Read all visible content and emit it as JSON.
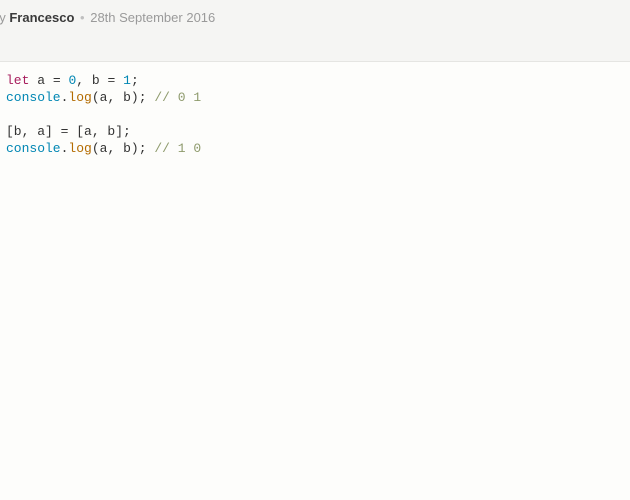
{
  "meta": {
    "by_label": "by",
    "author": "Francesco",
    "separator": "•",
    "date": "28th September 2016"
  },
  "code": {
    "line1": {
      "let": "let",
      "a": "a",
      "eq1": "=",
      "zero": "0",
      "comma": ",",
      "b": "b",
      "eq2": "=",
      "one": "1",
      "semi": ";"
    },
    "line2": {
      "console": "console",
      "dot": ".",
      "log": "log",
      "lp": "(",
      "a": "a",
      "comma": ",",
      "b": "b",
      "rp": ")",
      "semi": ";",
      "comment": "// 0 1"
    },
    "line4": {
      "text": "[b, a] = [a, b];"
    },
    "line5": {
      "console": "console",
      "dot": ".",
      "log": "log",
      "lp": "(",
      "a": "a",
      "comma": ",",
      "b": "b",
      "rp": ")",
      "semi": ";",
      "comment": "// 1 0"
    }
  }
}
